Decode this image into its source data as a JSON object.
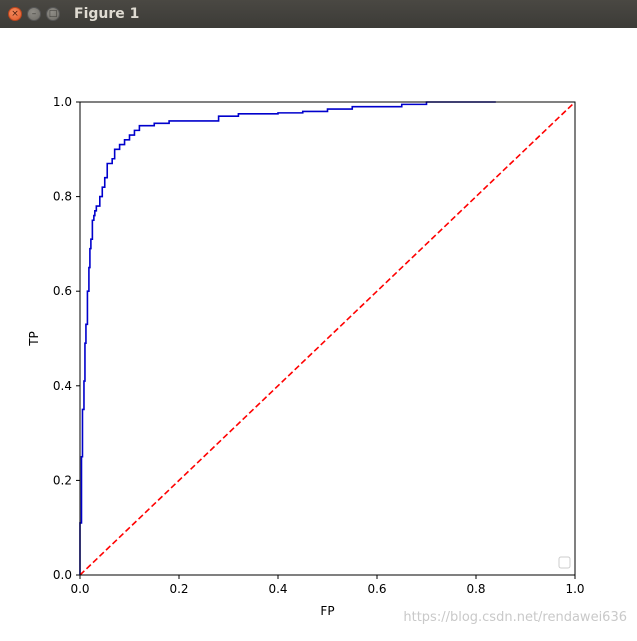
{
  "window": {
    "title": "Figure 1",
    "close_glyph": "×",
    "minimize_glyph": "–",
    "maximize_glyph": "□"
  },
  "watermark": "https://blog.csdn.net/rendawei636",
  "colors": {
    "roc_curve": "#0000cc",
    "diagonal": "#ff0000"
  },
  "chart_data": {
    "type": "line",
    "title": "",
    "xlabel": "FP",
    "ylabel": "TP",
    "xlim": [
      0,
      1
    ],
    "ylim": [
      0,
      1
    ],
    "xticks": [
      "0.0",
      "0.2",
      "0.4",
      "0.6",
      "0.8",
      "1.0"
    ],
    "yticks": [
      "0.0",
      "0.2",
      "0.4",
      "0.6",
      "0.8",
      "1.0"
    ],
    "grid": false,
    "legend": "lower-right",
    "series": [
      {
        "style": "solid",
        "step": true,
        "x": [
          0.0,
          0.0,
          0.003,
          0.005,
          0.008,
          0.01,
          0.012,
          0.015,
          0.018,
          0.02,
          0.022,
          0.025,
          0.028,
          0.03,
          0.033,
          0.035,
          0.04,
          0.045,
          0.05,
          0.055,
          0.06,
          0.065,
          0.07,
          0.08,
          0.09,
          0.1,
          0.11,
          0.12,
          0.13,
          0.15,
          0.18,
          0.22,
          0.28,
          0.32,
          0.4,
          0.45,
          0.5,
          0.55,
          0.6,
          0.65,
          0.7,
          0.75,
          0.84
        ],
        "y": [
          0.0,
          0.11,
          0.25,
          0.35,
          0.41,
          0.49,
          0.53,
          0.6,
          0.65,
          0.69,
          0.71,
          0.75,
          0.76,
          0.77,
          0.78,
          0.78,
          0.8,
          0.82,
          0.84,
          0.87,
          0.87,
          0.88,
          0.9,
          0.91,
          0.92,
          0.93,
          0.94,
          0.95,
          0.95,
          0.955,
          0.96,
          0.96,
          0.97,
          0.975,
          0.977,
          0.98,
          0.985,
          0.99,
          0.99,
          0.995,
          1.0,
          1.0,
          1.0
        ]
      },
      {
        "style": "dashed",
        "x": [
          0,
          1
        ],
        "y": [
          0,
          1
        ]
      }
    ]
  }
}
